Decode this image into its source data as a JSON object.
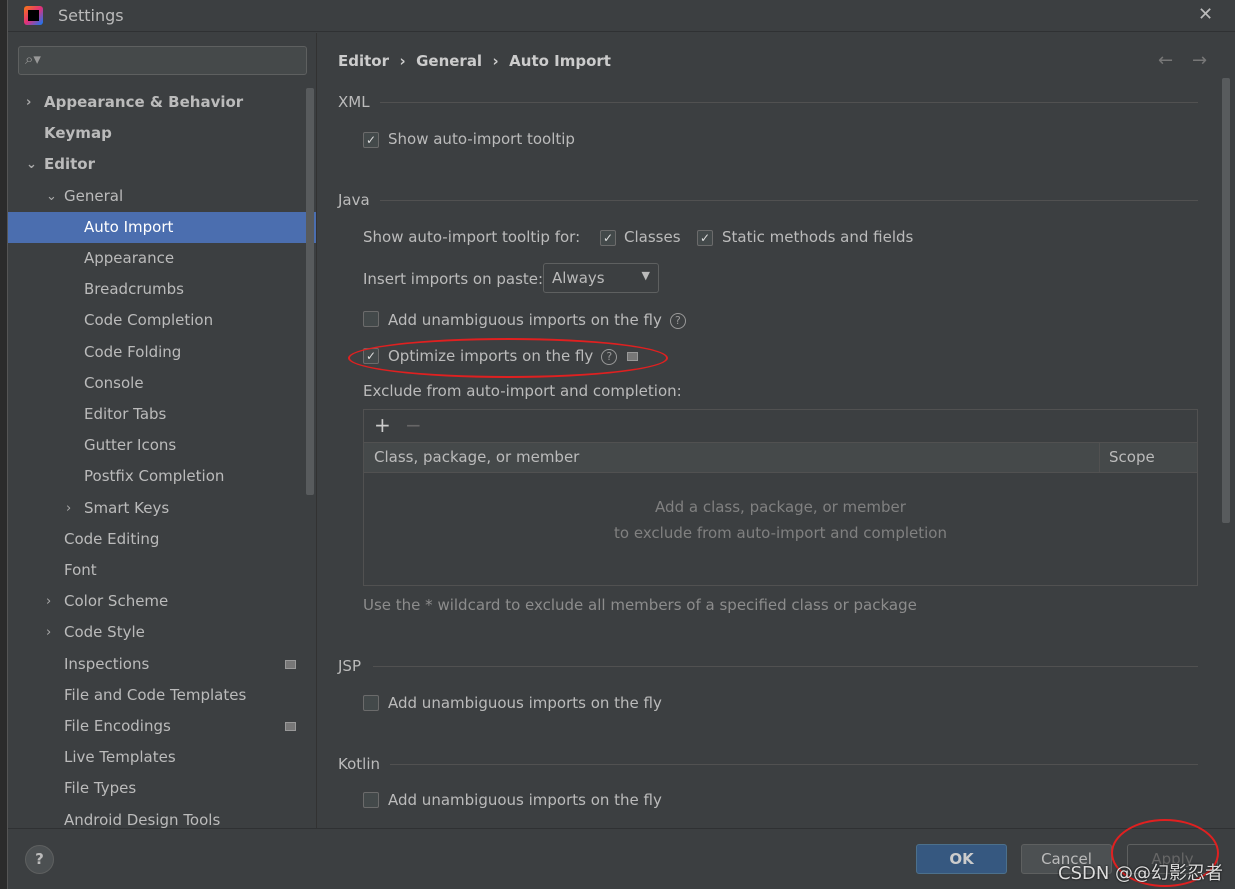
{
  "window": {
    "title": "Settings",
    "close": "✕"
  },
  "search": {
    "placeholder": ""
  },
  "tree": [
    {
      "label": "Appearance & Behavior",
      "level": 0,
      "bold": true,
      "chevron": "›"
    },
    {
      "label": "Keymap",
      "level": 0,
      "bold": true,
      "chevron": ""
    },
    {
      "label": "Editor",
      "level": 0,
      "bold": true,
      "chevron": "⌄"
    },
    {
      "label": "General",
      "level": 1,
      "chevron": "⌄"
    },
    {
      "label": "Auto Import",
      "level": 2,
      "selected": true
    },
    {
      "label": "Appearance",
      "level": 2
    },
    {
      "label": "Breadcrumbs",
      "level": 2
    },
    {
      "label": "Code Completion",
      "level": 2
    },
    {
      "label": "Code Folding",
      "level": 2
    },
    {
      "label": "Console",
      "level": 2
    },
    {
      "label": "Editor Tabs",
      "level": 2
    },
    {
      "label": "Gutter Icons",
      "level": 2
    },
    {
      "label": "Postfix Completion",
      "level": 2
    },
    {
      "label": "Smart Keys",
      "level": 2,
      "chevron": "›"
    },
    {
      "label": "Code Editing",
      "level": 1
    },
    {
      "label": "Font",
      "level": 1
    },
    {
      "label": "Color Scheme",
      "level": 1,
      "chevron": "›"
    },
    {
      "label": "Code Style",
      "level": 1,
      "chevron": "›"
    },
    {
      "label": "Inspections",
      "level": 1,
      "badge": true
    },
    {
      "label": "File and Code Templates",
      "level": 1
    },
    {
      "label": "File Encodings",
      "level": 1,
      "badge": true
    },
    {
      "label": "Live Templates",
      "level": 1
    },
    {
      "label": "File Types",
      "level": 1
    },
    {
      "label": "Android Design Tools",
      "level": 1
    }
  ],
  "breadcrumb": [
    "Editor",
    "General",
    "Auto Import"
  ],
  "nav": {
    "back": "←",
    "forward": "→"
  },
  "xml": {
    "title": "XML",
    "show_tooltip": "Show auto-import tooltip"
  },
  "java": {
    "title": "Java",
    "tooltip_for": "Show auto-import tooltip for:",
    "classes": "Classes",
    "static": "Static methods and fields",
    "insert_label": "Insert imports on paste:",
    "insert_value": "Always",
    "unambiguous": "Add unambiguous imports on the fly",
    "optimize": "Optimize imports on the fly",
    "exclude_label": "Exclude from auto-import and completion:",
    "add": "+",
    "remove": "−",
    "col1": "Class, package, or member",
    "col2": "Scope",
    "empty1": "Add a class, package, or member",
    "empty2": "to exclude from auto-import and completion",
    "hint": "Use the * wildcard to exclude all members of a specified class or package"
  },
  "jsp": {
    "title": "JSP",
    "unambiguous": "Add unambiguous imports on the fly"
  },
  "kotlin": {
    "title": "Kotlin",
    "unambiguous": "Add unambiguous imports on the fly"
  },
  "footer": {
    "help": "?",
    "ok": "OK",
    "cancel": "Cancel",
    "apply": "Apply"
  },
  "watermark": "CSDN @@幻影忍者",
  "colors": {
    "selection": "#4b6eaf",
    "ok_button": "#365880",
    "annotation": "#e02020"
  }
}
